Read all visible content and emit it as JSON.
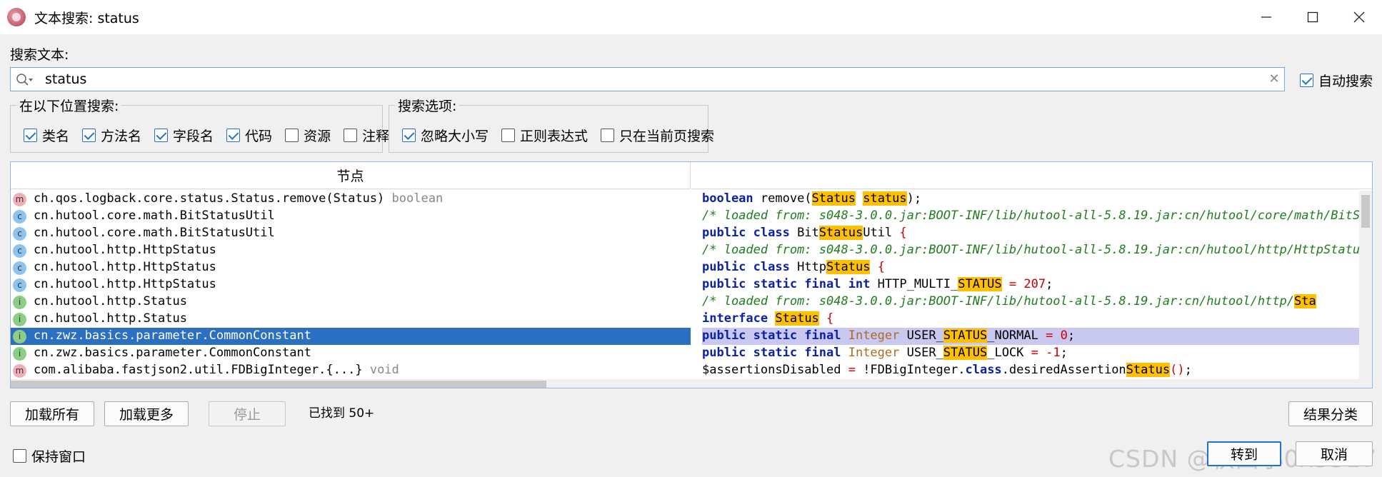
{
  "window": {
    "title": "文本搜索: status"
  },
  "search": {
    "label": "搜索文本:",
    "value": "status",
    "auto_search_label": "自动搜索",
    "auto_search_checked": true
  },
  "locations": {
    "legend": "在以下位置搜索:",
    "options": [
      {
        "label": "类名",
        "checked": true
      },
      {
        "label": "方法名",
        "checked": true
      },
      {
        "label": "字段名",
        "checked": true
      },
      {
        "label": "代码",
        "checked": true
      },
      {
        "label": "资源",
        "checked": false
      },
      {
        "label": "注释",
        "checked": false
      }
    ]
  },
  "search_options": {
    "legend": "搜索选项:",
    "options": [
      {
        "label": "忽略大小写",
        "checked": true
      },
      {
        "label": "正则表达式",
        "checked": false
      },
      {
        "label": "只在当前页搜索",
        "checked": false
      }
    ]
  },
  "results": {
    "header_node": "节点",
    "header_code": "",
    "rows": [
      {
        "icon": "m",
        "node": "ch.qos.logback.core.status.Status.remove(Status)",
        "type": "boolean",
        "selected": false,
        "code": [
          [
            "kw",
            "boolean"
          ],
          [
            "t",
            " remove("
          ],
          [
            "hl",
            "Status"
          ],
          [
            "t",
            " "
          ],
          [
            "hl",
            "status"
          ],
          [
            "t",
            ");"
          ]
        ]
      },
      {
        "icon": "c",
        "node": "cn.hutool.core.math.BitStatusUtil",
        "type": "",
        "selected": false,
        "code": [
          [
            "cm",
            "/* loaded from: s048-3.0.0.jar:BOOT-INF/lib/hutool-all-5.8.19.jar:cn/hutool/core/math/BitStatusUtil.class */"
          ]
        ]
      },
      {
        "icon": "c",
        "node": "cn.hutool.core.math.BitStatusUtil",
        "type": "",
        "selected": false,
        "code": [
          [
            "kw",
            "public class"
          ],
          [
            "t",
            " Bit"
          ],
          [
            "hl",
            "Status"
          ],
          [
            "t",
            "Util "
          ],
          [
            "op",
            "{"
          ]
        ]
      },
      {
        "icon": "c",
        "node": "cn.hutool.http.HttpStatus",
        "type": "",
        "selected": false,
        "code": [
          [
            "cm",
            "/* loaded from: s048-3.0.0.jar:BOOT-INF/lib/hutool-all-5.8.19.jar:cn/hutool/http/HttpStatus.class */"
          ]
        ]
      },
      {
        "icon": "c",
        "node": "cn.hutool.http.HttpStatus",
        "type": "",
        "selected": false,
        "code": [
          [
            "kw",
            "public class"
          ],
          [
            "t",
            " Http"
          ],
          [
            "hl",
            "Status"
          ],
          [
            "t",
            " "
          ],
          [
            "op",
            "{"
          ]
        ]
      },
      {
        "icon": "c",
        "node": "cn.hutool.http.HttpStatus",
        "type": "",
        "selected": false,
        "code": [
          [
            "kw",
            "public static final int"
          ],
          [
            "t",
            " HTTP_MULTI_"
          ],
          [
            "hl",
            "STATUS"
          ],
          [
            "t",
            " "
          ],
          [
            "op",
            "="
          ],
          [
            "t",
            " "
          ],
          [
            "num2",
            "207"
          ],
          [
            "t",
            ";"
          ]
        ]
      },
      {
        "icon": "i",
        "node": "cn.hutool.http.Status",
        "type": "",
        "selected": false,
        "code": [
          [
            "cm",
            "/* loaded from: s048-3.0.0.jar:BOOT-INF/lib/hutool-all-5.8.19.jar:cn/hutool/http/"
          ],
          [
            "hl",
            "Sta"
          ]
        ]
      },
      {
        "icon": "i",
        "node": "cn.hutool.http.Status",
        "type": "",
        "selected": false,
        "code": [
          [
            "kw",
            "interface"
          ],
          [
            "t",
            " "
          ],
          [
            "hl",
            "Status"
          ],
          [
            "t",
            " "
          ],
          [
            "op",
            "{"
          ]
        ]
      },
      {
        "icon": "i",
        "node": "cn.zwz.basics.parameter.CommonConstant",
        "type": "",
        "selected": true,
        "code": [
          [
            "kw",
            "public static final"
          ],
          [
            "t",
            " "
          ],
          [
            "kt",
            "Integer"
          ],
          [
            "t",
            " USER_"
          ],
          [
            "hl",
            "STATUS"
          ],
          [
            "t",
            "_NORMAL "
          ],
          [
            "op",
            "="
          ],
          [
            "t",
            " "
          ],
          [
            "num2",
            "0"
          ],
          [
            "t",
            ";"
          ]
        ]
      },
      {
        "icon": "i",
        "node": "cn.zwz.basics.parameter.CommonConstant",
        "type": "",
        "selected": false,
        "code": [
          [
            "kw",
            "public static final"
          ],
          [
            "t",
            " "
          ],
          [
            "kt",
            "Integer"
          ],
          [
            "t",
            " USER_"
          ],
          [
            "hl",
            "STATUS"
          ],
          [
            "t",
            "_LOCK "
          ],
          [
            "op",
            "="
          ],
          [
            "t",
            " "
          ],
          [
            "num2",
            "-1"
          ],
          [
            "t",
            ";"
          ]
        ]
      },
      {
        "icon": "m",
        "node": "com.alibaba.fastjson2.util.FDBigInteger.{...}",
        "type": "void",
        "selected": false,
        "code": [
          [
            "t",
            "$assertionsDisabled "
          ],
          [
            "op",
            "="
          ],
          [
            "t",
            " !FDBigInteger."
          ],
          [
            "kw",
            "class"
          ],
          [
            "t",
            ".desiredAssertion"
          ],
          [
            "hl",
            "Status"
          ],
          [
            "op",
            "()"
          ],
          [
            "t",
            ";"
          ]
        ]
      }
    ]
  },
  "actions": {
    "load_all": "加载所有",
    "load_more": "加载更多",
    "stop": "停止",
    "found": "已找到  50+",
    "group_results": "结果分类",
    "keep_window": "保持窗口",
    "goto": "转到",
    "cancel": "取消"
  },
  "watermark": "CSDN @秋田小0x5517"
}
